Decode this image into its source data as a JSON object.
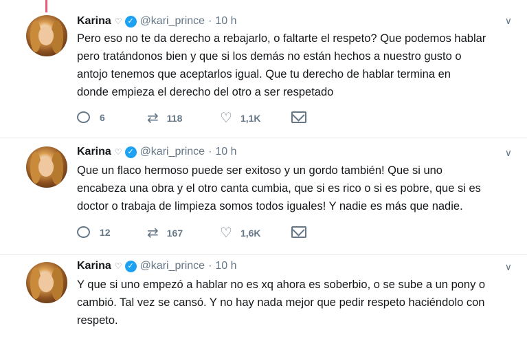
{
  "tweets": [
    {
      "name": "Karina",
      "handle": "@kari_prince",
      "separator": "·",
      "time": "10 h",
      "text": "Pero eso no te da derecho a rebajarlo, o faltarte el respeto? Que podemos hablar\npero tratándonos bien y que si los demás no están  hechos a nuestro gusto o\nantojo tenemos que aceptarlos igual. Que tu derecho de hablar termina en\ndonde empieza el derecho del otro a ser respetado",
      "replies": "6",
      "retweets": "118",
      "likes": "1,1K"
    },
    {
      "name": "Karina",
      "handle": "@kari_prince",
      "separator": "·",
      "time": "10 h",
      "text": "Que un flaco hermoso puede ser exitoso y un gordo también! Que si uno\nencabeza una obra y el otro canta cumbia, que si es rico o si es pobre, que si es\ndoctor o trabaja de limpieza somos todos iguales! Y nadie es más que nadie.",
      "replies": "12",
      "retweets": "167",
      "likes": "1,6K"
    },
    {
      "name": "Karina",
      "handle": "@kari_prince",
      "separator": "·",
      "time": "10 h",
      "text": "Y que si uno empezó a hablar no es xq ahora es soberbio, o se sube a un pony o\ncambió. Tal vez se cansó. Y no hay nada mejor que pedir respeto haciéndolo con\nrespeto."
    }
  ],
  "icons": {
    "verified": "verified-badge-icon",
    "heart_small": "heart-outline-icon",
    "caret": "chevron-down-icon",
    "reply": "reply-icon",
    "retweet": "retweet-icon",
    "like": "like-icon",
    "dm": "direct-message-icon"
  },
  "colors": {
    "verified_blue": "#1da1f2",
    "thread_line": "#e65c78",
    "secondary_text": "#657786",
    "primary_text": "#14171a"
  }
}
